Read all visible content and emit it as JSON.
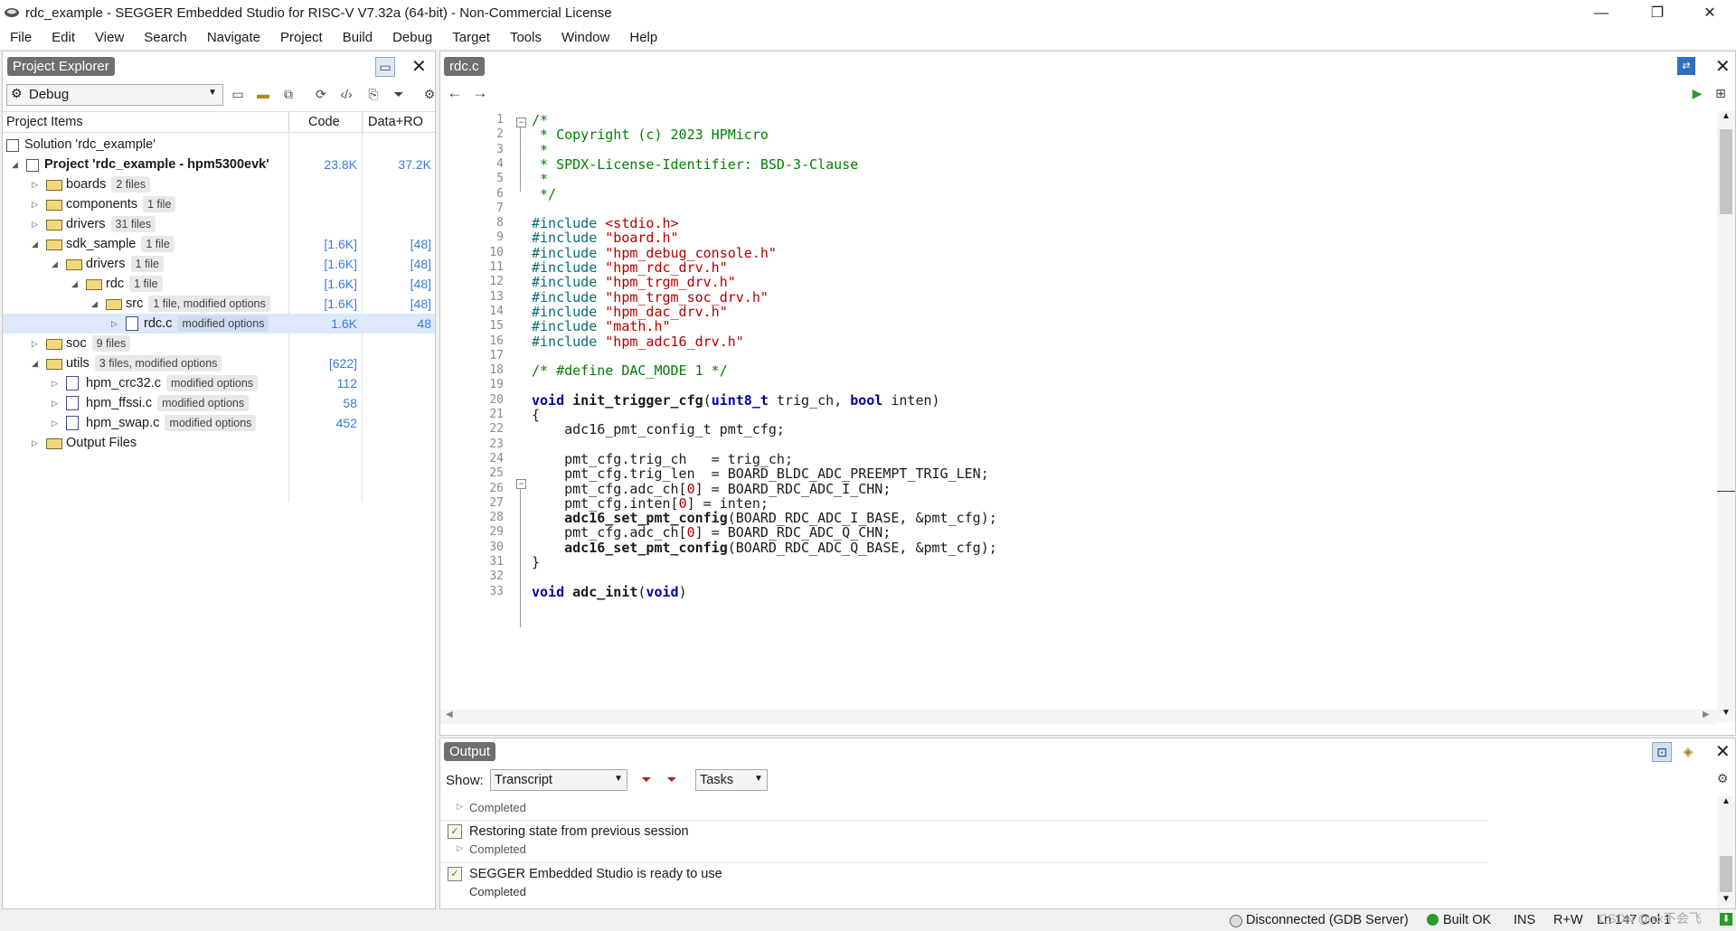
{
  "window": {
    "title": "rdc_example - SEGGER Embedded Studio for RISC-V V7.32a (64-bit) - Non-Commercial License",
    "minimize": "—",
    "restore": "❐",
    "close": "✕"
  },
  "menu": [
    "File",
    "Edit",
    "View",
    "Search",
    "Navigate",
    "Project",
    "Build",
    "Debug",
    "Target",
    "Tools",
    "Window",
    "Help"
  ],
  "project_explorer": {
    "tab": "Project Explorer",
    "config": "Debug",
    "columns": {
      "items": "Project Items",
      "code": "Code",
      "data": "Data+RO"
    },
    "rows": [
      {
        "label": "Solution 'rdc_example'",
        "badge": "",
        "code": "",
        "data": ""
      },
      {
        "label": "Project 'rdc_example - hpm5300evk'",
        "badge": "",
        "code": "23.8K",
        "data": "37.2K"
      },
      {
        "label": "boards",
        "badge": "2 files",
        "code": "",
        "data": ""
      },
      {
        "label": "components",
        "badge": "1 file",
        "code": "",
        "data": ""
      },
      {
        "label": "drivers",
        "badge": "31 files",
        "code": "",
        "data": ""
      },
      {
        "label": "sdk_sample",
        "badge": "1 file",
        "code": "[1.6K]",
        "data": "[48]"
      },
      {
        "label": "drivers",
        "badge": "1 file",
        "code": "[1.6K]",
        "data": "[48]"
      },
      {
        "label": "rdc",
        "badge": "1 file",
        "code": "[1.6K]",
        "data": "[48]"
      },
      {
        "label": "src",
        "badge": "1 file, modified options",
        "code": "[1.6K]",
        "data": "[48]"
      },
      {
        "label": "rdc.c",
        "badge": "modified options",
        "code": "1.6K",
        "data": "48"
      },
      {
        "label": "soc",
        "badge": "9 files",
        "code": "",
        "data": ""
      },
      {
        "label": "utils",
        "badge": "3 files, modified options",
        "code": "[622]",
        "data": ""
      },
      {
        "label": "hpm_crc32.c",
        "badge": "modified options",
        "code": "112",
        "data": ""
      },
      {
        "label": "hpm_ffssi.c",
        "badge": "modified options",
        "code": "58",
        "data": ""
      },
      {
        "label": "hpm_swap.c",
        "badge": "modified options",
        "code": "452",
        "data": ""
      },
      {
        "label": "Output Files",
        "badge": "",
        "code": "",
        "data": ""
      }
    ]
  },
  "editor": {
    "tab": "rdc.c",
    "lines": [
      {
        "n": "1",
        "t": "/*"
      },
      {
        "n": "2",
        "t": " * Copyright (c) 2023 HPMicro"
      },
      {
        "n": "3",
        "t": " *"
      },
      {
        "n": "4",
        "t": " * SPDX-License-Identifier: BSD-3-Clause"
      },
      {
        "n": "5",
        "t": " *"
      },
      {
        "n": "6",
        "t": " */"
      },
      {
        "n": "7",
        "t": ""
      },
      {
        "n": "8",
        "t": "#include <stdio.h>"
      },
      {
        "n": "9",
        "t": "#include \"board.h\""
      },
      {
        "n": "10",
        "t": "#include \"hpm_debug_console.h\""
      },
      {
        "n": "11",
        "t": "#include \"hpm_rdc_drv.h\""
      },
      {
        "n": "12",
        "t": "#include \"hpm_trgm_drv.h\""
      },
      {
        "n": "13",
        "t": "#include \"hpm_trgm_soc_drv.h\""
      },
      {
        "n": "14",
        "t": "#include \"hpm_dac_drv.h\""
      },
      {
        "n": "15",
        "t": "#include \"math.h\""
      },
      {
        "n": "16",
        "t": "#include \"hpm_adc16_drv.h\""
      },
      {
        "n": "17",
        "t": ""
      },
      {
        "n": "18",
        "t": "/* #define DAC_MODE 1 */"
      },
      {
        "n": "19",
        "t": ""
      },
      {
        "n": "20",
        "t": "void init_trigger_cfg(uint8_t trig_ch, bool inten)"
      },
      {
        "n": "21",
        "t": "{"
      },
      {
        "n": "22",
        "t": "    adc16_pmt_config_t pmt_cfg;"
      },
      {
        "n": "23",
        "t": ""
      },
      {
        "n": "24",
        "t": "    pmt_cfg.trig_ch   = trig_ch;"
      },
      {
        "n": "25",
        "t": "    pmt_cfg.trig_len  = BOARD_BLDC_ADC_PREEMPT_TRIG_LEN;"
      },
      {
        "n": "26",
        "t": "    pmt_cfg.adc_ch[0] = BOARD_RDC_ADC_I_CHN;"
      },
      {
        "n": "27",
        "t": "    pmt_cfg.inten[0] = inten;"
      },
      {
        "n": "28",
        "t": "    adc16_set_pmt_config(BOARD_RDC_ADC_I_BASE, &pmt_cfg);"
      },
      {
        "n": "29",
        "t": "    pmt_cfg.adc_ch[0] = BOARD_RDC_ADC_Q_CHN;"
      },
      {
        "n": "30",
        "t": "    adc16_set_pmt_config(BOARD_RDC_ADC_Q_BASE, &pmt_cfg);"
      },
      {
        "n": "31",
        "t": "}"
      },
      {
        "n": "32",
        "t": ""
      },
      {
        "n": "33",
        "t": "void adc_init(void)"
      }
    ]
  },
  "output": {
    "tab": "Output",
    "show_label": "Show:",
    "show_value": "Transcript",
    "tasks_value": "Tasks",
    "items": [
      {
        "title": "",
        "status": "Completed"
      },
      {
        "title": "Restoring state from previous session",
        "status": "Completed"
      },
      {
        "title": "SEGGER Embedded Studio is ready to use",
        "status": "Completed"
      }
    ]
  },
  "status": {
    "connection": "Disconnected (GDB Server)",
    "build": "Built OK",
    "ins": "INS",
    "rw": "R+W",
    "pos": "Ln 147 Col 1",
    "watermark": "CSDN @xx不会飞"
  }
}
